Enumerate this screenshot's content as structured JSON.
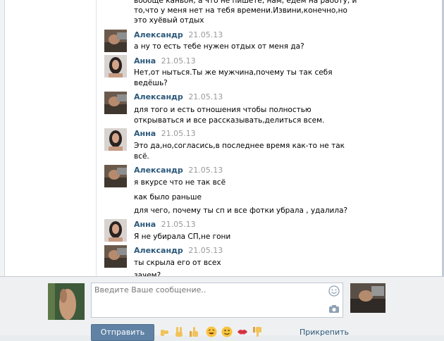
{
  "conversation": {
    "top_lines": [
      "вообще каньон, а что не пишете, нам, едем на работу, и",
      "то,что у меня нет на тебя времени.Извини,конечно,но",
      "это хуёвый отдых"
    ],
    "messages": [
      {
        "author": "Александр",
        "date": "21.05.13",
        "lines": [
          "а ну то есть тебе нужен отдых от меня да?"
        ]
      },
      {
        "author": "Анна",
        "date": "21.05.13",
        "lines": [
          "Нет,от ныться.Ты же мужчина,почему ты так себя",
          "ведёшь?"
        ]
      },
      {
        "author": "Александр",
        "date": "21.05.13",
        "lines": [
          "для того и есть отношения чтобы полностью",
          "открываться и все рассказывать,делиться всем."
        ]
      },
      {
        "author": "Анна",
        "date": "21.05.13",
        "lines": [
          "Это да,но,согласись,в последнее время как-то не так",
          "всё."
        ]
      },
      {
        "author": "Александр",
        "date": "21.05.13",
        "lines": [
          "я вкурсе что не так всё",
          "как было раньше",
          "для чего, почему ты сп и все фотки убрала , удалила?"
        ]
      },
      {
        "author": "Анна",
        "date": "21.05.13",
        "lines": [
          "Я не убирала СП,не гони"
        ]
      },
      {
        "author": "Александр",
        "date": "21.05.13",
        "lines": [
          "ты скрыла его от всех",
          "зачем?"
        ]
      }
    ]
  },
  "composer": {
    "placeholder": "Введите Ваше сообщение..",
    "send_label": "Отправить",
    "attach_label": "Прикрепить",
    "smile_icon": "smile-icon",
    "photo_icon": "camera-icon",
    "emojis": [
      "hand-pointing-right-emoji",
      "victory-hand-emoji",
      "thumbs-up-emoji",
      "laughing-face-emoji",
      "winking-face-emoji",
      "kiss-lips-emoji",
      "thumbs-down-emoji"
    ]
  },
  "colors": {
    "author": "#2b587a",
    "date": "#999999",
    "send_button": "#6082a4",
    "composer_bg": "#eef0f2"
  }
}
